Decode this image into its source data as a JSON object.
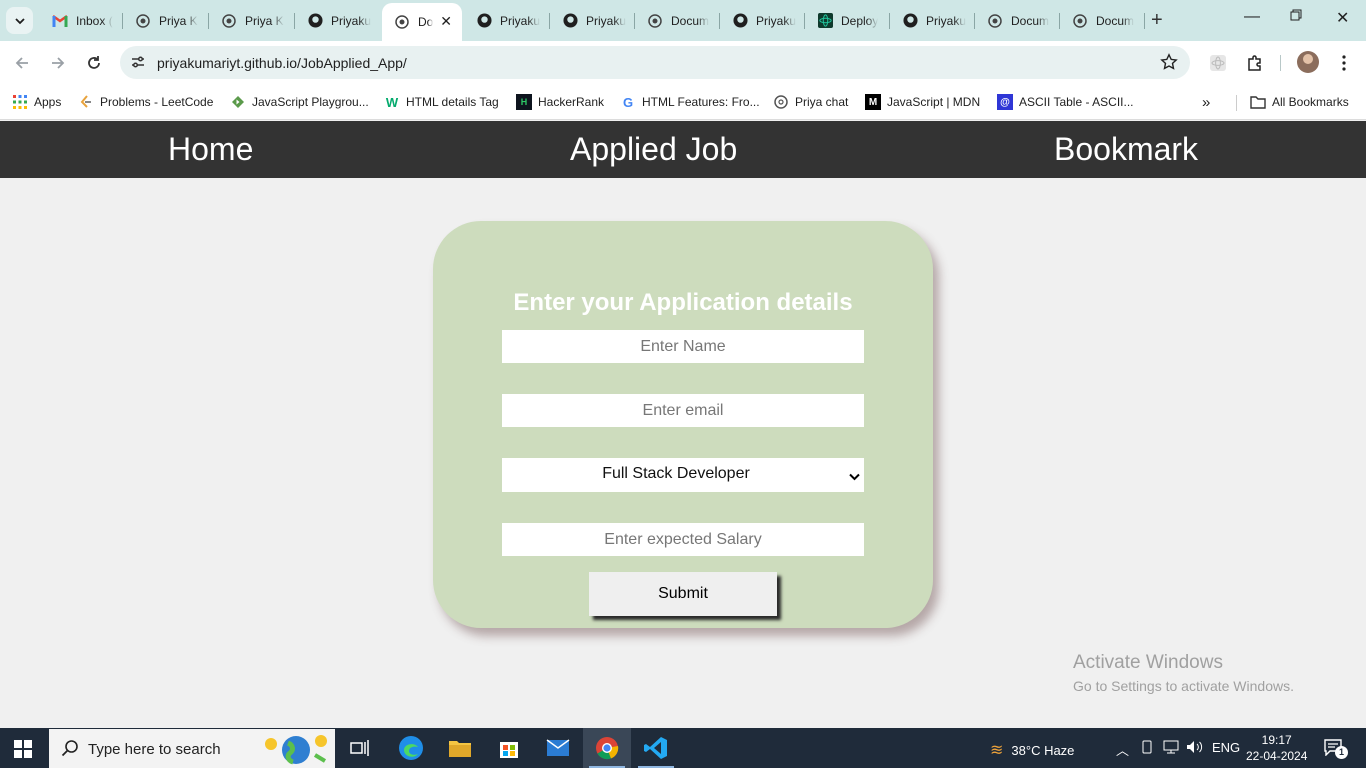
{
  "browser": {
    "tabs": [
      {
        "label": "Inbox (",
        "icon": "gmail-icon"
      },
      {
        "label": "Priya K",
        "icon": "globe-icon"
      },
      {
        "label": "Priya K",
        "icon": "globe-icon"
      },
      {
        "label": "Priyaku",
        "icon": "github-icon"
      },
      {
        "label": "Do",
        "icon": "globe-icon",
        "active": true
      },
      {
        "label": "Priyaku",
        "icon": "github-icon"
      },
      {
        "label": "Priyaku",
        "icon": "github-icon"
      },
      {
        "label": "Docum",
        "icon": "globe-icon"
      },
      {
        "label": "Priyaku",
        "icon": "github-icon"
      },
      {
        "label": "Deploy",
        "icon": "react-icon"
      },
      {
        "label": "Priyaku",
        "icon": "github-icon"
      },
      {
        "label": "Docum",
        "icon": "globe-icon"
      },
      {
        "label": "Docum",
        "icon": "globe-icon"
      }
    ],
    "url": "priyakumariyt.github.io/JobApplied_App/",
    "bookmarks": [
      {
        "label": "Apps",
        "icon": "apps-grid-icon"
      },
      {
        "label": "Problems - LeetCode",
        "icon": "leetcode-icon"
      },
      {
        "label": "JavaScript Playgrou...",
        "icon": "playground-icon"
      },
      {
        "label": "HTML details Tag",
        "icon": "w3schools-icon"
      },
      {
        "label": "HackerRank",
        "icon": "hackerrank-icon"
      },
      {
        "label": "HTML Features: Fro...",
        "icon": "g-icon"
      },
      {
        "label": "Priya chat",
        "icon": "chatgpt-icon"
      },
      {
        "label": "JavaScript | MDN",
        "icon": "mdn-icon"
      },
      {
        "label": "ASCII Table - ASCII...",
        "icon": "ascii-icon"
      }
    ],
    "all_bookmarks_label": "All Bookmarks"
  },
  "site": {
    "nav": {
      "home": "Home",
      "applied": "Applied Job",
      "bookmark": "Bookmark"
    },
    "form": {
      "title": "Enter your Application details",
      "name_placeholder": "Enter Name",
      "email_placeholder": "Enter email",
      "role_selected": "Full Stack Developer",
      "salary_placeholder": "Enter expected Salary",
      "submit_label": "Submit"
    }
  },
  "watermark": {
    "line1": "Activate Windows",
    "line2": "Go to Settings to activate Windows."
  },
  "taskbar": {
    "search_placeholder": "Type here to search",
    "weather": "38°C  Haze",
    "language": "ENG",
    "time": "19:17",
    "date": "22-04-2024",
    "notification_count": "1"
  },
  "colors": {
    "nav_bg": "#333333",
    "card_bg": "#cddcbd",
    "page_bg": "#f0f0f0",
    "taskbar_bg": "#1f2b3a"
  }
}
